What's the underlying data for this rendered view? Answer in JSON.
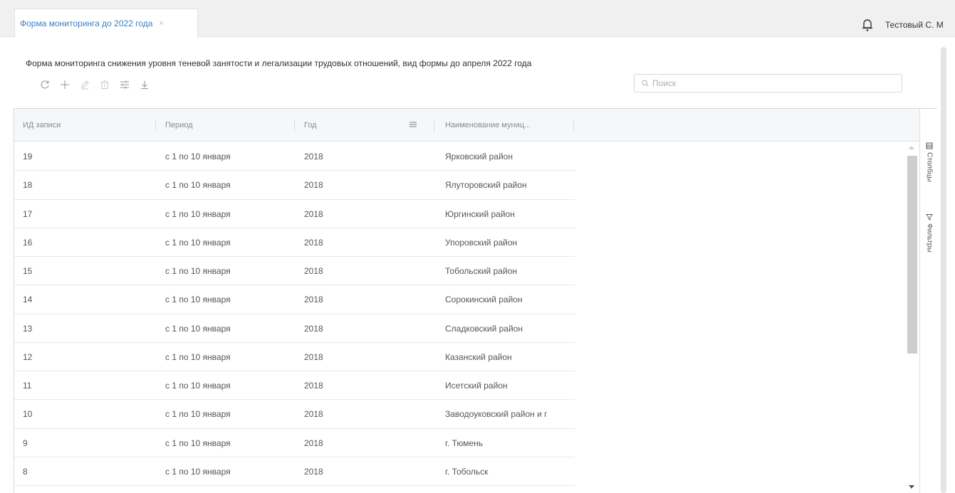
{
  "tab": {
    "label": "Форма мониторинга до 2022 года",
    "close": "×"
  },
  "user": {
    "name": "Тестовый С. М"
  },
  "page": {
    "title": "Форма мониторинга снижения уровня теневой занятости и легализации трудовых отношений, вид формы до апреля 2022 года"
  },
  "search": {
    "placeholder": "Поиск"
  },
  "grid": {
    "columns": [
      "ИД записи",
      "Период",
      "Год",
      "Наименование муниц..."
    ],
    "rows": [
      [
        "19",
        "с 1 по 10 января",
        "2018",
        "Ярковский район"
      ],
      [
        "18",
        "с 1 по 10 января",
        "2018",
        "Ялуторовский район"
      ],
      [
        "17",
        "с 1 по 10 января",
        "2018",
        "Юргинский район"
      ],
      [
        "16",
        "с 1 по 10 января",
        "2018",
        "Упоровский район"
      ],
      [
        "15",
        "с 1 по 10 января",
        "2018",
        "Тобольский район"
      ],
      [
        "14",
        "с 1 по 10 января",
        "2018",
        "Сорокинский район"
      ],
      [
        "13",
        "с 1 по 10 января",
        "2018",
        "Сладковский район"
      ],
      [
        "12",
        "с 1 по 10 января",
        "2018",
        "Казанский район"
      ],
      [
        "11",
        "с 1 по 10 января",
        "2018",
        "Исетский район"
      ],
      [
        "10",
        "с 1 по 10 января",
        "2018",
        "Заводоуковский район и г"
      ],
      [
        "9",
        "с 1 по 10 января",
        "2018",
        "г. Тюмень"
      ],
      [
        "8",
        "с 1 по 10 января",
        "2018",
        "г. Тобольск"
      ]
    ]
  },
  "side_panel": {
    "columns_label": "Столбцы",
    "filters_label": "Фильтры"
  },
  "icons": {
    "bell": "bell-icon",
    "refresh": "refresh-icon",
    "add": "plus-icon",
    "edit": "pencil-icon",
    "delete": "trash-icon",
    "settings": "sliders-icon",
    "download": "download-icon",
    "search": "search-icon",
    "column_menu": "menu-icon",
    "columns": "columns-icon",
    "filter": "filter-icon"
  },
  "colors": {
    "accent": "#3a7fc4",
    "header_bg": "#f6f7f9",
    "topbar_bg": "#f0f0f0"
  }
}
